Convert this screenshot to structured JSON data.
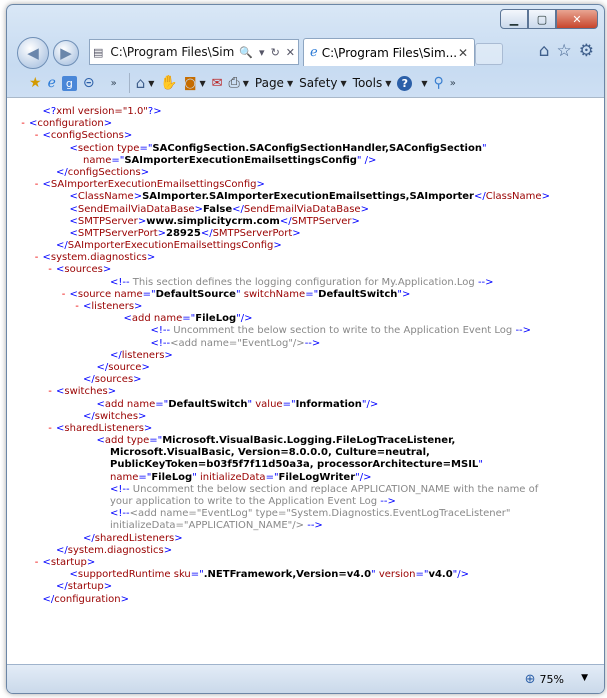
{
  "address_bar": {
    "text": "C:\\Program Files\\Sim",
    "search_icon": "🔍",
    "refresh_icon": "↻",
    "close_icon": "✕"
  },
  "tab": {
    "title": "C:\\Program Files\\Sim...",
    "close": "✕"
  },
  "command_bar": {
    "page_label": "Page",
    "safety_label": "Safety",
    "tools_label": "Tools"
  },
  "status_bar": {
    "zoom": "75%"
  },
  "xml_lines": [
    {
      "indent": 1,
      "marker": "",
      "html": "<span class=\"b\">&lt;?</span><span class=\"t\">xml version=\"1.0\"</span><span class=\"b\">?&gt;</span>"
    },
    {
      "indent": 0,
      "marker": "-",
      "html": "<span class=\"b\">&lt;</span><span class=\"t\">configuration</span><span class=\"b\">&gt;</span>"
    },
    {
      "indent": 1,
      "marker": "-",
      "html": "<span class=\"b\">&lt;</span><span class=\"t\">configSections</span><span class=\"b\">&gt;</span>"
    },
    {
      "indent": 3,
      "marker": "",
      "html": "<span class=\"b\">&lt;</span><span class=\"t\">section </span><span class=\"a\">type</span><span class=\"b\">=\"</span><span class=\"v\">SAConfigSection.SAConfigSectionHandler,SAConfigSection</span><span class=\"b\">\"</span>"
    },
    {
      "indent": 4,
      "marker": "",
      "html": "<span class=\"a\">name</span><span class=\"b\">=\"</span><span class=\"v\">SAImporterExecutionEmailsettingsConfig</span><span class=\"b\">\" /&gt;</span>"
    },
    {
      "indent": 2,
      "marker": "",
      "html": "<span class=\"b\">&lt;/</span><span class=\"t\">configSections</span><span class=\"b\">&gt;</span>"
    },
    {
      "indent": 1,
      "marker": "-",
      "html": "<span class=\"b\">&lt;</span><span class=\"t\">SAImporterExecutionEmailsettingsConfig</span><span class=\"b\">&gt;</span>"
    },
    {
      "indent": 3,
      "marker": "",
      "html": "<span class=\"b\">&lt;</span><span class=\"t\">ClassName</span><span class=\"b\">&gt;</span><span class=\"v\">SAImporter.SAImporterExecutionEmailsettings,SAImporter</span><span class=\"b\">&lt;/</span><span class=\"t\">ClassName</span><span class=\"b\">&gt;</span>"
    },
    {
      "indent": 3,
      "marker": "",
      "html": "<span class=\"b\">&lt;</span><span class=\"t\">SendEmailViaDataBase</span><span class=\"b\">&gt;</span><span class=\"v\">False</span><span class=\"b\">&lt;/</span><span class=\"t\">SendEmailViaDataBase</span><span class=\"b\">&gt;</span>"
    },
    {
      "indent": 3,
      "marker": "",
      "html": "<span class=\"b\">&lt;</span><span class=\"t\">SMTPServer</span><span class=\"b\">&gt;</span><span class=\"v\">www.simplicitycrm.com</span><span class=\"b\">&lt;/</span><span class=\"t\">SMTPServer</span><span class=\"b\">&gt;</span>"
    },
    {
      "indent": 3,
      "marker": "",
      "html": "<span class=\"b\">&lt;</span><span class=\"t\">SMTPServerPort</span><span class=\"b\">&gt;</span><span class=\"v\">28925</span><span class=\"b\">&lt;/</span><span class=\"t\">SMTPServerPort</span><span class=\"b\">&gt;</span>"
    },
    {
      "indent": 2,
      "marker": "",
      "html": "<span class=\"b\">&lt;/</span><span class=\"t\">SAImporterExecutionEmailsettingsConfig</span><span class=\"b\">&gt;</span>"
    },
    {
      "indent": 1,
      "marker": "-",
      "html": "<span class=\"b\">&lt;</span><span class=\"t\">system.diagnostics</span><span class=\"b\">&gt;</span>"
    },
    {
      "indent": 2,
      "marker": "-",
      "html": "<span class=\"b\">&lt;</span><span class=\"t\">sources</span><span class=\"b\">&gt;</span>"
    },
    {
      "indent": 6,
      "marker": "",
      "html": "<span class=\"b\">&lt;!--</span><span class=\"c\"> This section defines the logging configuration for My.Application.Log </span><span class=\"b\">--&gt;</span>"
    },
    {
      "indent": 3,
      "marker": "-",
      "html": "<span class=\"b\">&lt;</span><span class=\"t\">source </span><span class=\"a\">name</span><span class=\"b\">=\"</span><span class=\"v\">DefaultSource</span><span class=\"b\">\" </span><span class=\"a\">switchName</span><span class=\"b\">=\"</span><span class=\"v\">DefaultSwitch</span><span class=\"b\">\"&gt;</span>"
    },
    {
      "indent": 4,
      "marker": "-",
      "html": "<span class=\"b\">&lt;</span><span class=\"t\">listeners</span><span class=\"b\">&gt;</span>"
    },
    {
      "indent": 7,
      "marker": "",
      "html": "<span class=\"b\">&lt;</span><span class=\"t\">add </span><span class=\"a\">name</span><span class=\"b\">=\"</span><span class=\"v\">FileLog</span><span class=\"b\">\"/&gt;</span>"
    },
    {
      "indent": 9,
      "marker": "",
      "html": "<span class=\"b\">&lt;!--</span><span class=\"c\"> Uncomment the below section to write to the Application Event Log </span><span class=\"b\">--&gt;</span>"
    },
    {
      "indent": 9,
      "marker": "",
      "html": "<span class=\"b\">&lt;!--</span><span class=\"c\">&lt;add name=\"EventLog\"/&gt;</span><span class=\"b\">--&gt;</span>"
    },
    {
      "indent": 6,
      "marker": "",
      "html": "<span class=\"b\">&lt;/</span><span class=\"t\">listeners</span><span class=\"b\">&gt;</span>"
    },
    {
      "indent": 5,
      "marker": "",
      "html": "<span class=\"b\">&lt;/</span><span class=\"t\">source</span><span class=\"b\">&gt;</span>"
    },
    {
      "indent": 4,
      "marker": "",
      "html": "<span class=\"b\">&lt;/</span><span class=\"t\">sources</span><span class=\"b\">&gt;</span>"
    },
    {
      "indent": 2,
      "marker": "-",
      "html": "<span class=\"b\">&lt;</span><span class=\"t\">switches</span><span class=\"b\">&gt;</span>"
    },
    {
      "indent": 5,
      "marker": "",
      "html": "<span class=\"b\">&lt;</span><span class=\"t\">add </span><span class=\"a\">name</span><span class=\"b\">=\"</span><span class=\"v\">DefaultSwitch</span><span class=\"b\">\" </span><span class=\"a\">value</span><span class=\"b\">=\"</span><span class=\"v\">Information</span><span class=\"b\">\"/&gt;</span>"
    },
    {
      "indent": 4,
      "marker": "",
      "html": "<span class=\"b\">&lt;/</span><span class=\"t\">switches</span><span class=\"b\">&gt;</span>"
    },
    {
      "indent": 2,
      "marker": "-",
      "html": "<span class=\"b\">&lt;</span><span class=\"t\">sharedListeners</span><span class=\"b\">&gt;</span>"
    },
    {
      "indent": 5,
      "marker": "",
      "html": "<span class=\"b\">&lt;</span><span class=\"t\">add </span><span class=\"a\">type</span><span class=\"b\">=\"</span><span class=\"v\">Microsoft.VisualBasic.Logging.FileLogTraceListener,</span>"
    },
    {
      "indent": 6,
      "marker": "",
      "html": "<span class=\"v\">Microsoft.VisualBasic, Version=8.0.0.0, Culture=neutral,</span>"
    },
    {
      "indent": 6,
      "marker": "",
      "html": "<span class=\"v\">PublicKeyToken=b03f5f7f11d50a3a, processorArchitecture=MSIL</span><span class=\"b\">\"</span>"
    },
    {
      "indent": 6,
      "marker": "",
      "html": "<span class=\"a\">name</span><span class=\"b\">=\"</span><span class=\"v\">FileLog</span><span class=\"b\">\" </span><span class=\"a\">initializeData</span><span class=\"b\">=\"</span><span class=\"v\">FileLogWriter</span><span class=\"b\">\"/&gt;</span>"
    },
    {
      "indent": 6,
      "marker": "",
      "html": "<span class=\"b\">&lt;!--</span><span class=\"c\"> Uncomment the below section and replace APPLICATION_NAME with the name of</span>"
    },
    {
      "indent": 6,
      "marker": "",
      "html": "<span class=\"c\">your application to write to the Application Event Log </span><span class=\"b\">--&gt;</span>"
    },
    {
      "indent": 6,
      "marker": "",
      "html": "<span class=\"b\">&lt;!--</span><span class=\"c\">&lt;add name=\"EventLog\" type=\"System.Diagnostics.EventLogTraceListener\"</span>"
    },
    {
      "indent": 6,
      "marker": "",
      "html": "<span class=\"c\">initializeData=\"APPLICATION_NAME\"/&gt; </span><span class=\"b\">--&gt;</span>"
    },
    {
      "indent": 4,
      "marker": "",
      "html": "<span class=\"b\">&lt;/</span><span class=\"t\">sharedListeners</span><span class=\"b\">&gt;</span>"
    },
    {
      "indent": 2,
      "marker": "",
      "html": "<span class=\"b\">&lt;/</span><span class=\"t\">system.diagnostics</span><span class=\"b\">&gt;</span>"
    },
    {
      "indent": 1,
      "marker": "-",
      "html": "<span class=\"b\">&lt;</span><span class=\"t\">startup</span><span class=\"b\">&gt;</span>"
    },
    {
      "indent": 3,
      "marker": "",
      "html": "<span class=\"b\">&lt;</span><span class=\"t\">supportedRuntime </span><span class=\"a\">sku</span><span class=\"b\">=\"</span><span class=\"v\">.NETFramework,Version=v4.0</span><span class=\"b\">\" </span><span class=\"a\">version</span><span class=\"b\">=\"</span><span class=\"v\">v4.0</span><span class=\"b\">\"/&gt;</span>"
    },
    {
      "indent": 2,
      "marker": "",
      "html": "<span class=\"b\">&lt;/</span><span class=\"t\">startup</span><span class=\"b\">&gt;</span>"
    },
    {
      "indent": 1,
      "marker": "",
      "html": "<span class=\"b\">&lt;/</span><span class=\"t\">configuration</span><span class=\"b\">&gt;</span>"
    }
  ],
  "colors": {
    "tag": "#990000",
    "markup": "#0000ff",
    "value": "#000000",
    "comment": "#888888",
    "expand_marker": "#ee0000"
  }
}
